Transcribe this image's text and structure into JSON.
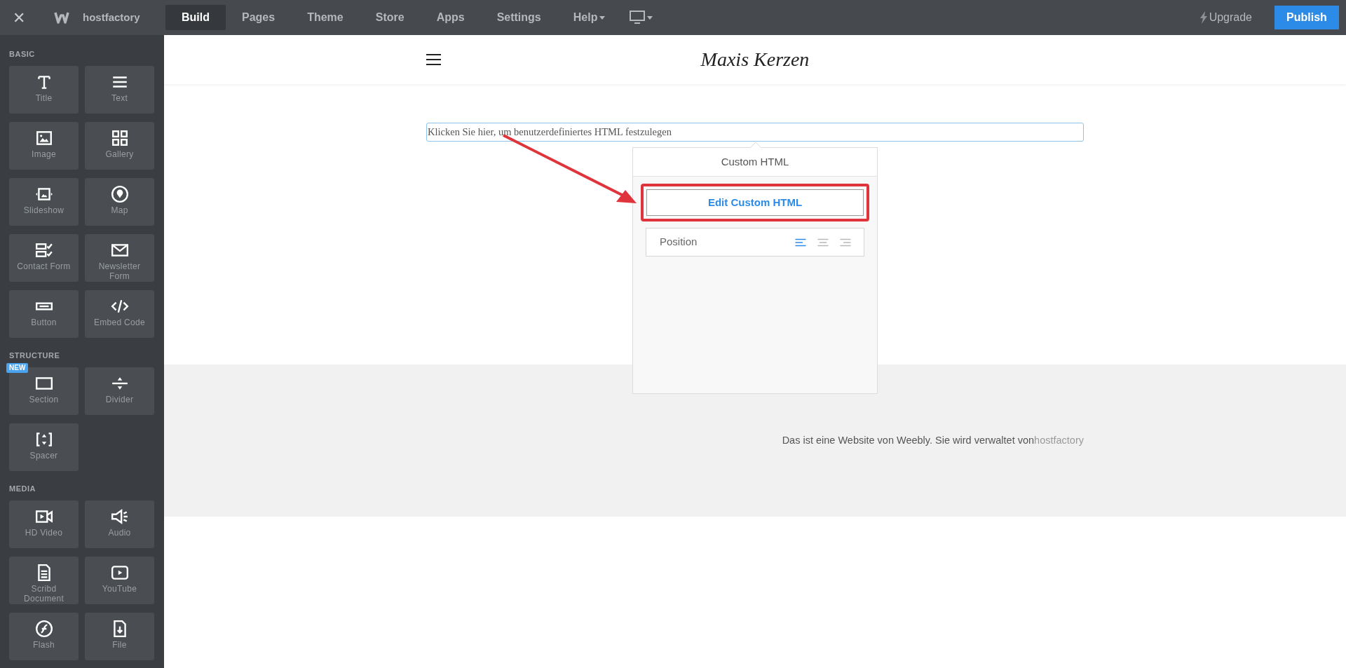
{
  "topbar": {
    "close": "✕",
    "brand": "hostfactory",
    "tabs": [
      {
        "label": "Build",
        "selected": true,
        "caret": false
      },
      {
        "label": "Pages",
        "selected": false,
        "caret": false
      },
      {
        "label": "Theme",
        "selected": false,
        "caret": false
      },
      {
        "label": "Store",
        "selected": false,
        "caret": false
      },
      {
        "label": "Apps",
        "selected": false,
        "caret": false
      },
      {
        "label": "Settings",
        "selected": false,
        "caret": false
      },
      {
        "label": "Help",
        "selected": false,
        "caret": true
      }
    ],
    "upgrade": "Upgrade",
    "publish": "Publish"
  },
  "sidebar": {
    "sections": [
      {
        "title": "BASIC",
        "items": [
          {
            "label": "Title",
            "kind": "title"
          },
          {
            "label": "Text",
            "kind": "text"
          },
          {
            "label": "Image",
            "kind": "image"
          },
          {
            "label": "Gallery",
            "kind": "gallery"
          },
          {
            "label": "Slideshow",
            "kind": "slideshow"
          },
          {
            "label": "Map",
            "kind": "map"
          },
          {
            "label": "Contact Form",
            "kind": "form"
          },
          {
            "label": "Newsletter Form",
            "kind": "mail"
          },
          {
            "label": "Button",
            "kind": "button"
          },
          {
            "label": "Embed Code",
            "kind": "code"
          }
        ]
      },
      {
        "title": "STRUCTURE",
        "items": [
          {
            "label": "Section",
            "kind": "section",
            "badge": "NEW"
          },
          {
            "label": "Divider",
            "kind": "divider"
          },
          {
            "label": "Spacer",
            "kind": "spacer"
          }
        ]
      },
      {
        "title": "MEDIA",
        "items": [
          {
            "label": "HD Video",
            "kind": "video"
          },
          {
            "label": "Audio",
            "kind": "audio"
          },
          {
            "label": "Scribd Document",
            "kind": "doc"
          },
          {
            "label": "YouTube",
            "kind": "youtube"
          },
          {
            "label": "Flash",
            "kind": "flash"
          },
          {
            "label": "File",
            "kind": "file"
          }
        ]
      }
    ]
  },
  "site": {
    "title": "Maxis Kerzen",
    "html_block": "Klicken Sie hier, um benutzerdefiniertes HTML festzulegen",
    "footer_text": "Das ist eine Website von Weebly. Sie wird verwaltet von",
    "footer_link": "hostfactory"
  },
  "popup": {
    "title": "Custom HTML",
    "button": "Edit Custom HTML",
    "position": {
      "label": "Position",
      "options": [
        {
          "kind": "left",
          "selected": true
        },
        {
          "kind": "center",
          "selected": false
        },
        {
          "kind": "right",
          "selected": false
        }
      ]
    }
  }
}
